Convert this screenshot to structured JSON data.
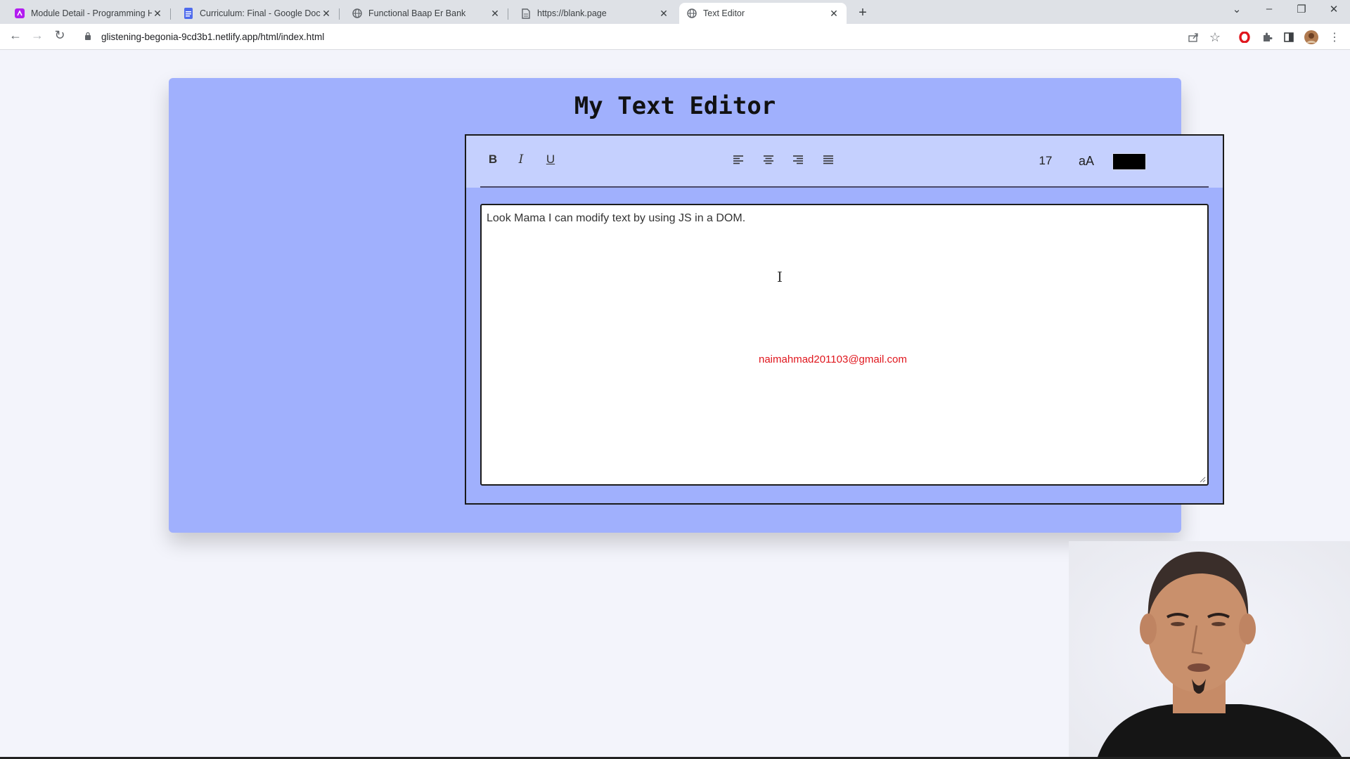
{
  "browser": {
    "tabs": [
      {
        "title": "Module Detail - Programming He",
        "favicon": "module-icon"
      },
      {
        "title": "Curriculum: Final - Google Docs",
        "favicon": "docs-icon"
      },
      {
        "title": "Functional Baap Er Bank",
        "favicon": "globe-icon"
      },
      {
        "title": "https://blank.page",
        "favicon": "page-icon"
      },
      {
        "title": "Text Editor",
        "favicon": "globe-icon",
        "active": true
      }
    ],
    "url": "glistening-begonia-9cd3b1.netlify.app/html/index.html"
  },
  "app": {
    "title": "My Text Editor",
    "buttons": {
      "bold": "B",
      "italic": "I",
      "underline": "U"
    },
    "font_size": "17",
    "case_toggle": "aA",
    "color_value": "#000000",
    "content": "Look Mama I can modify text by using JS in a DOM."
  },
  "overlay": {
    "email": "naimahmad201103@gmail.com"
  },
  "colors": {
    "panel": "#a0b0fd",
    "controls": "#c5d0fe",
    "email": "#e0161d"
  }
}
